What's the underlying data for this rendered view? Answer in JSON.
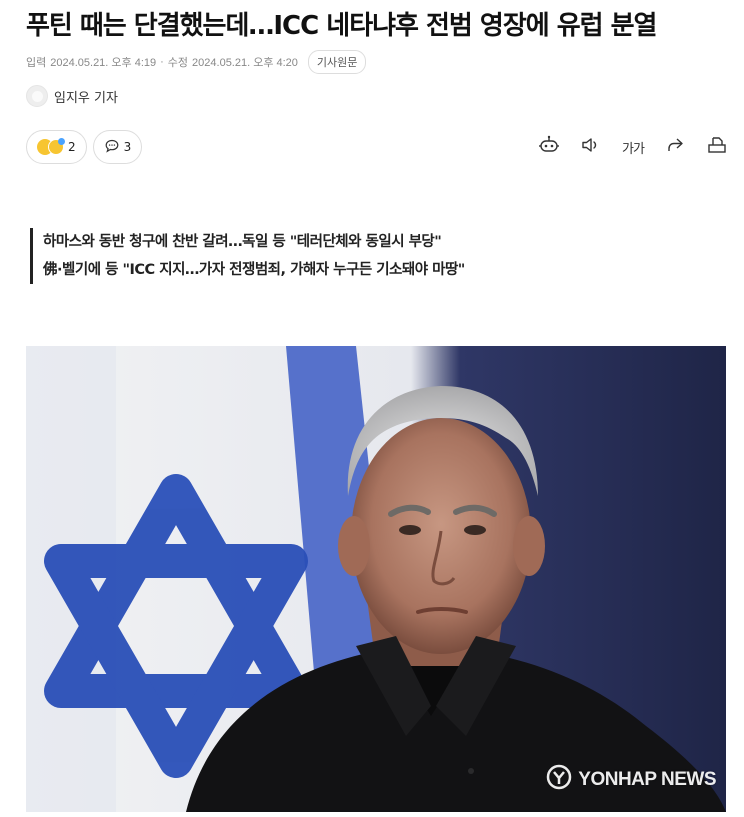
{
  "article": {
    "headline": "푸틴 때는 단결했는데…ICC 네타냐후 전범 영장에 유럽 분열",
    "input_label": "입력",
    "input_time": "2024.05.21. 오후 4:19",
    "separator": "·",
    "modified_label": "수정",
    "modified_time": "2024.05.21. 오후 4:20",
    "original_button": "기사원문",
    "reporter": "임지우 기자"
  },
  "actions": {
    "reaction_count": "2",
    "comment_count": "3",
    "font_size_label": "가가"
  },
  "subheads": [
    "하마스와 동반 청구에 찬반 갈려…독일 등 \"테러단체와 동일시 부당\"",
    "佛·벨기에 등 \"ICC 지지…가자 전쟁범죄, 가해자 누구든 기소돼야 마땅\""
  ],
  "photo": {
    "credit": "YONHAP NEWS",
    "logo_icon": "yonhap-logo-icon"
  },
  "colors": {
    "flag_blue": "#2a4fb8",
    "background": "#ffffff",
    "text": "#111111"
  }
}
